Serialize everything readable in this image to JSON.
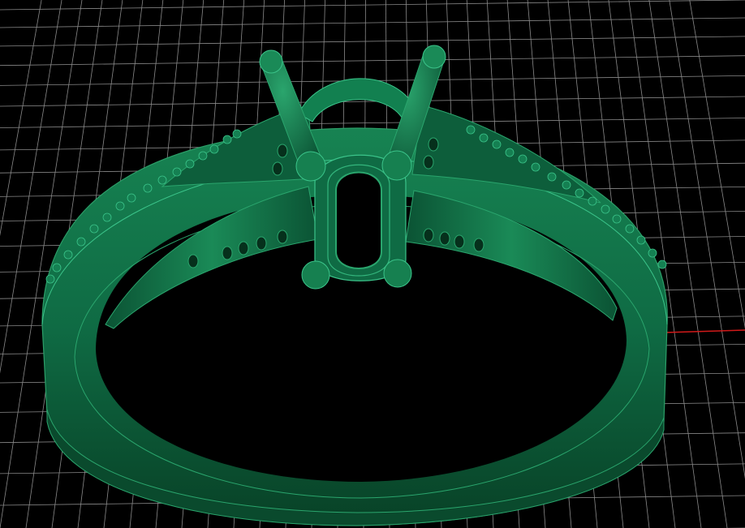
{
  "viewport": {
    "background": "#000000",
    "grid_color": "#8a8a8a",
    "grid_visible": true,
    "axis_x_color": "#d21a1a",
    "axis_y_color": "#1cc7d6"
  },
  "model": {
    "object": "ring-cad-model",
    "shading_color": "#0f6b44",
    "highlight_color": "#1f9a63",
    "shadow_color": "#07341f",
    "edge_color": "#39c184"
  }
}
